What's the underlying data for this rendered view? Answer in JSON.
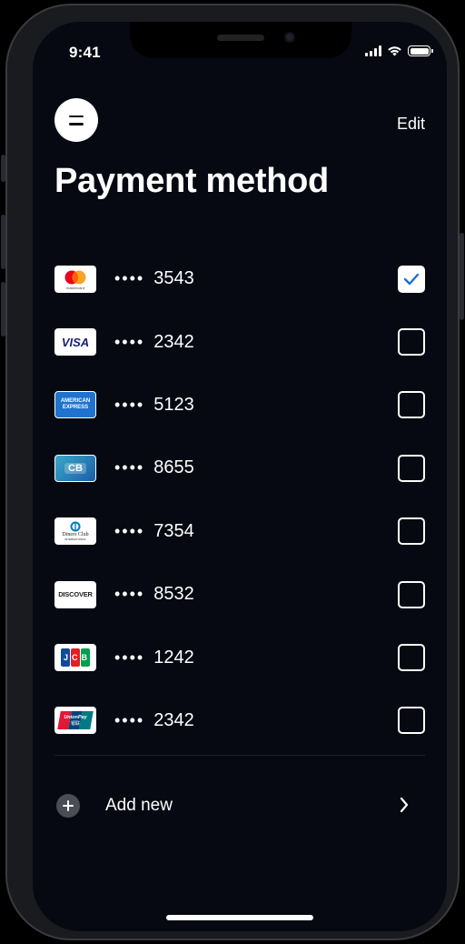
{
  "status": {
    "time": "9:41"
  },
  "header": {
    "edit_label": "Edit",
    "title": "Payment method"
  },
  "cards": [
    {
      "brand": "Mastercard",
      "masked": "••••",
      "last4": "3543",
      "selected": true
    },
    {
      "brand": "VISA",
      "masked": "••••",
      "last4": "2342",
      "selected": false
    },
    {
      "brand": "American Express",
      "masked": "••••",
      "last4": "5123",
      "selected": false
    },
    {
      "brand": "CB",
      "masked": "••••",
      "last4": "8655",
      "selected": false
    },
    {
      "brand": "Diners Club International",
      "masked": "••••",
      "last4": "7354",
      "selected": false
    },
    {
      "brand": "DISCOVER",
      "masked": "••••",
      "last4": "8532",
      "selected": false
    },
    {
      "brand": "JCB",
      "masked": "••••",
      "last4": "1242",
      "selected": false
    },
    {
      "brand": "UnionPay",
      "masked": "••••",
      "last4": "2342",
      "selected": false
    }
  ],
  "logo_text": {
    "mastercard": "mastercard",
    "visa": "VISA",
    "amex_top": "AMERICAN",
    "amex_bottom": "EXPRESS",
    "cb": "CB",
    "diners_top": "Diners Club",
    "diners_bottom": "INTERNATIONAL",
    "discover": "DISCOVER",
    "jcb": "JCB",
    "unionpay_top": "UnionPay",
    "unionpay_bottom": "银联"
  },
  "add_new": {
    "label": "Add new"
  },
  "colors": {
    "background": "#060912",
    "accent": "#1f6fd6",
    "text": "#ffffff"
  }
}
